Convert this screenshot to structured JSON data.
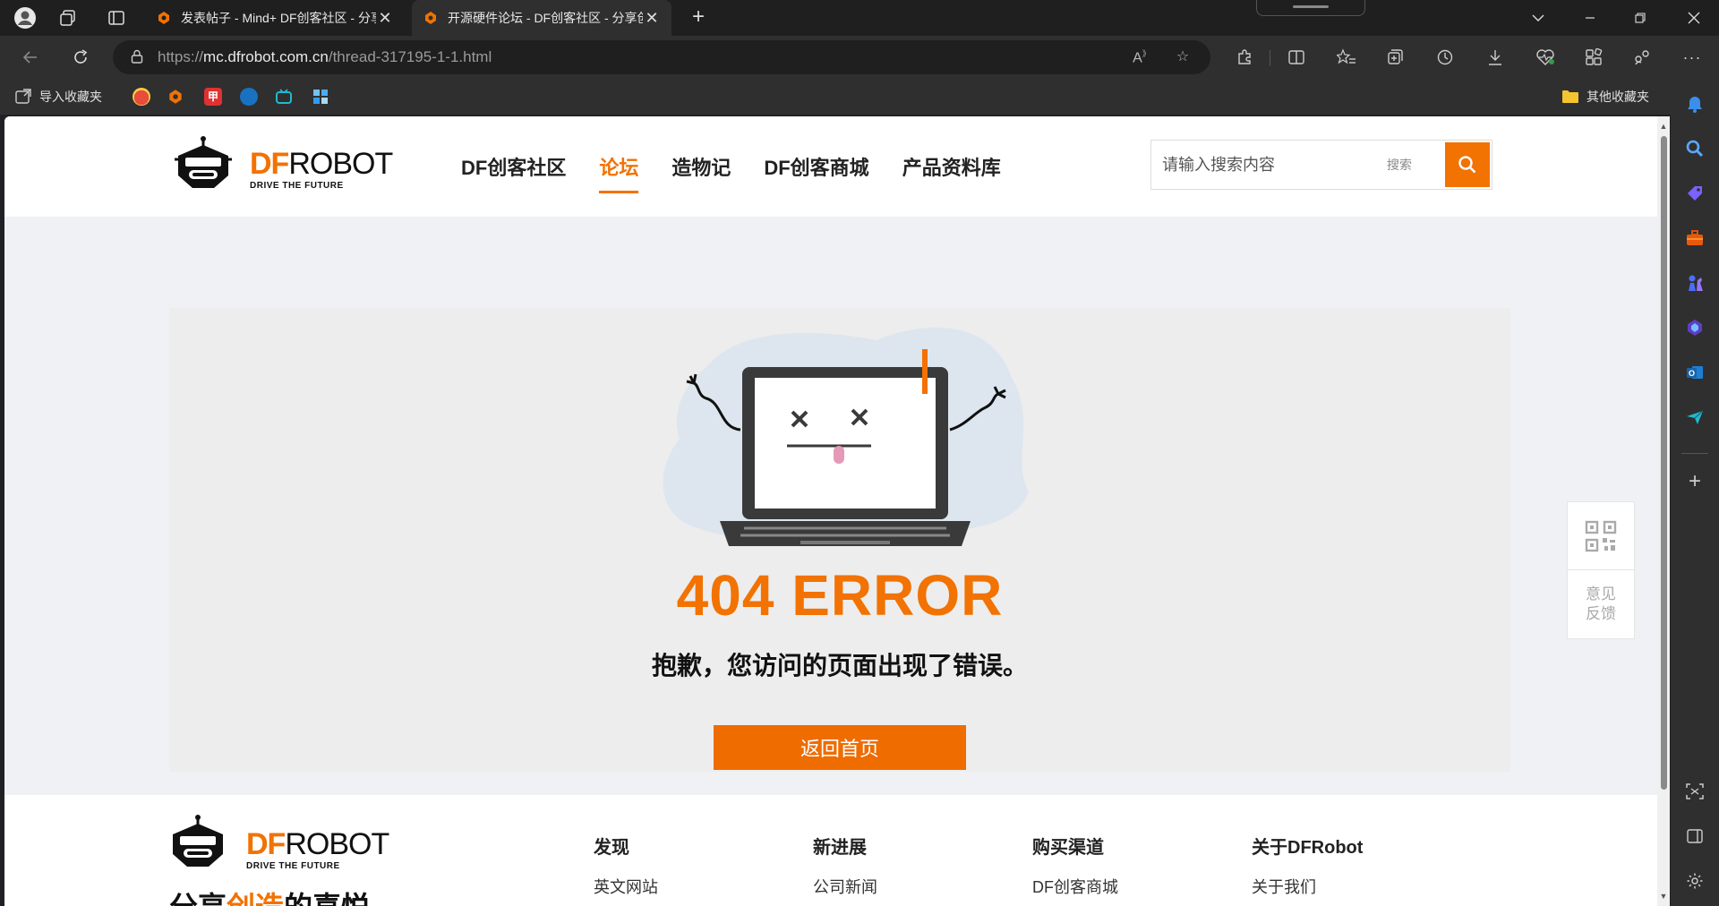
{
  "tabs": [
    {
      "title": "发表帖子 - Mind+ DF创客社区 - 分享创造的喜悦",
      "active": false
    },
    {
      "title": "开源硬件论坛 - DF创客社区 - 分享创造的喜悦",
      "active": true
    }
  ],
  "address": {
    "scheme": "https://",
    "host": "mc.dfrobot.com.cn",
    "path": "/thread-317195-1-1.html"
  },
  "favorites": {
    "import_label": "导入收藏夹",
    "other_label": "其他收藏夹"
  },
  "site": {
    "logo_df": "DF",
    "logo_robot": "ROBOT",
    "logo_tagline": "DRIVE THE FUTURE",
    "nav": [
      {
        "label": "DF创客社区",
        "active": false
      },
      {
        "label": "论坛",
        "active": true
      },
      {
        "label": "造物记",
        "active": false
      },
      {
        "label": "DF创客商城",
        "active": false
      },
      {
        "label": "产品资料库",
        "active": false
      }
    ],
    "search": {
      "placeholder": "请输入搜索内容",
      "label": "搜索"
    }
  },
  "error": {
    "title": "404 ERROR",
    "message": "抱歉，您访问的页面出现了错误。",
    "home_button": "返回首页"
  },
  "widget": {
    "feedback": "意见反馈"
  },
  "footer": {
    "slogan_prefix": "分享",
    "slogan_highlight": "创造",
    "slogan_suffix": "的喜悦",
    "columns": [
      {
        "title": "发现",
        "link": "英文网站"
      },
      {
        "title": "新进展",
        "link": "公司新闻"
      },
      {
        "title": "购买渠道",
        "link": "DF创客商城"
      },
      {
        "title": "关于DFRobot",
        "link": "关于我们"
      }
    ]
  },
  "colors": {
    "brand_orange": "#f27202",
    "button_orange": "#ee6c00",
    "page_bg": "#f0f1f4",
    "card_bg": "#ededed"
  }
}
